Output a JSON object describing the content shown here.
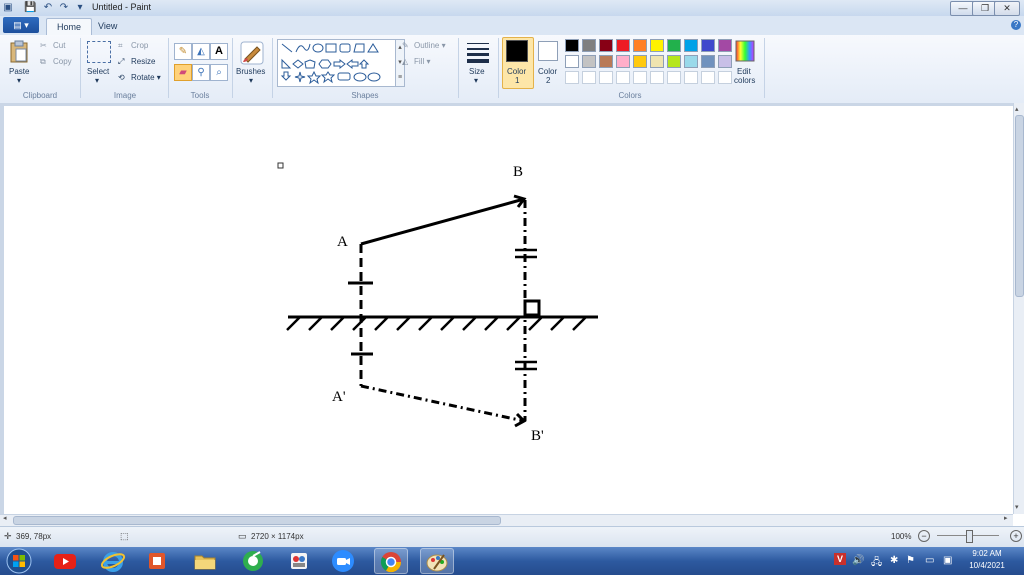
{
  "window": {
    "title": "Untitled - Paint",
    "controls": {
      "minimize": "—",
      "maximize": "❐",
      "close": "✕"
    }
  },
  "quick_access": [
    "save-icon",
    "undo-icon",
    "redo-icon",
    "customize-icon"
  ],
  "menu": {
    "file_label": "▤ ▾",
    "tabs": [
      "Home",
      "View"
    ],
    "active_tab": "Home",
    "help": "?"
  },
  "ribbon": {
    "clipboard": {
      "paste": "Paste",
      "cut": "Cut",
      "copy": "Copy",
      "label": "Clipboard"
    },
    "image": {
      "select": "Select",
      "crop": "Crop",
      "resize": "Resize",
      "rotate": "Rotate ▾",
      "label": "Image"
    },
    "tools": {
      "label": "Tools"
    },
    "brushes": {
      "label": "Brushes"
    },
    "shapes": {
      "label": "Shapes",
      "outline": "Outline ▾",
      "fill": "Fill ▾"
    },
    "size": {
      "label": "Size"
    },
    "colors": {
      "color1": "Color\n1",
      "color1_label": "Color",
      "color1_num": "1",
      "color2_label": "Color",
      "color2_num": "2",
      "edit": "Edit",
      "edit2": "colors",
      "label": "Colors",
      "color1_value": "#000000",
      "color2_value": "#ffffff",
      "palette_row1": [
        "#000000",
        "#7f7f7f",
        "#880015",
        "#ed1c24",
        "#ff7f27",
        "#fff200",
        "#22b14c",
        "#00a2e8",
        "#3f48cc",
        "#a349a4"
      ],
      "palette_row2": [
        "#ffffff",
        "#c3c3c3",
        "#b97a57",
        "#ffaec9",
        "#ffc90e",
        "#efe4b0",
        "#b5e61d",
        "#99d9ea",
        "#7092be",
        "#c8bfe7"
      ]
    }
  },
  "drawing": {
    "label_A": "A",
    "label_B": "B",
    "label_A_prime": "A'",
    "label_B_prime": "B'"
  },
  "status": {
    "cursor_pos": "369, 78px",
    "canvas_size": "2720 × 1174px",
    "zoom": "100%"
  },
  "taskbar": {
    "apps": [
      "windows-start",
      "youtube",
      "internet-explorer",
      "office",
      "file-explorer",
      "chrome-tool",
      "people",
      "zoom",
      "chrome",
      "paint"
    ],
    "tray": {
      "v": "V",
      "time": "9:02 AM",
      "date": "10/4/2021"
    }
  }
}
